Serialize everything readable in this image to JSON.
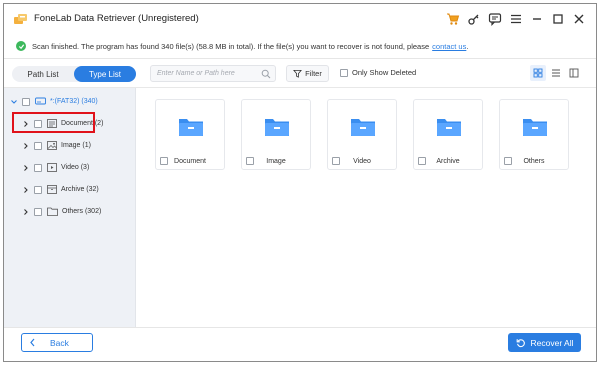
{
  "window": {
    "title": "FoneLab Data Retriever (Unregistered)",
    "icons": [
      "cart-icon",
      "key-icon",
      "chat-icon",
      "menu-icon",
      "minimize-icon",
      "maximize-icon",
      "close-icon"
    ]
  },
  "status": {
    "message": "Scan finished. The program has found 340 file(s) (58.8 MB in total). If the file(s) you want to recover is not found, please",
    "link": "contact us",
    "tail": "."
  },
  "tabs": [
    {
      "label": "Path List",
      "active": false
    },
    {
      "label": "Type List",
      "active": true
    }
  ],
  "toolbar": {
    "search_placeholder": "Enter Name or Path here",
    "filter_label": "Filter",
    "only_deleted_label": "Only Show Deleted"
  },
  "tree": {
    "root": "*:(FAT32) (340)",
    "items": [
      {
        "label": "Document (2)",
        "icon": "document-icon"
      },
      {
        "label": "Image (1)",
        "icon": "image-icon"
      },
      {
        "label": "Video (3)",
        "icon": "video-icon"
      },
      {
        "label": "Archive (32)",
        "icon": "archive-icon"
      },
      {
        "label": "Others (302)",
        "icon": "folder-icon"
      }
    ]
  },
  "cards": [
    {
      "label": "Document"
    },
    {
      "label": "Image"
    },
    {
      "label": "Video"
    },
    {
      "label": "Archive"
    },
    {
      "label": "Others"
    }
  ],
  "footer": {
    "back_label": "Back",
    "recover_label": "Recover All"
  },
  "colors": {
    "accent": "#2a7de1",
    "highlight": "#e0121a",
    "success": "#3cb85c",
    "cart": "#f0a020",
    "tree_bg": "#eef1f6"
  }
}
